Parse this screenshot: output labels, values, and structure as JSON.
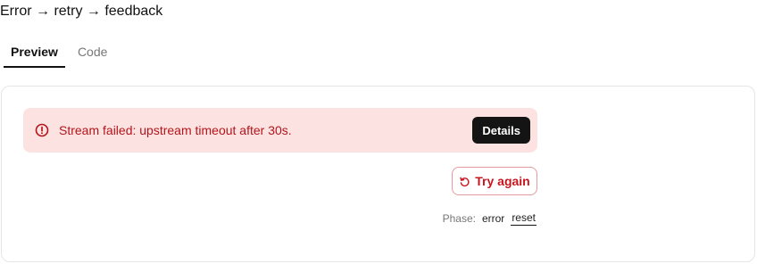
{
  "header": {
    "title": "Error → retry → feedback"
  },
  "tabs": [
    {
      "label": "Preview",
      "active": true
    },
    {
      "label": "Code",
      "active": false
    }
  ],
  "alert": {
    "message": "Stream failed: upstream timeout after 30s.",
    "details_label": "Details",
    "icon": "alert-circle-icon"
  },
  "retry": {
    "label": "Try again",
    "icon": "rotate-ccw-icon"
  },
  "phase": {
    "label": "Phase:",
    "options": [
      "error",
      "reset"
    ],
    "current": "reset"
  },
  "colors": {
    "alert_bg": "#fde2e2",
    "alert_text": "#b3151b",
    "retry_text": "#c8161f",
    "retry_border": "#e49a9e",
    "details_bg": "#141414"
  }
}
